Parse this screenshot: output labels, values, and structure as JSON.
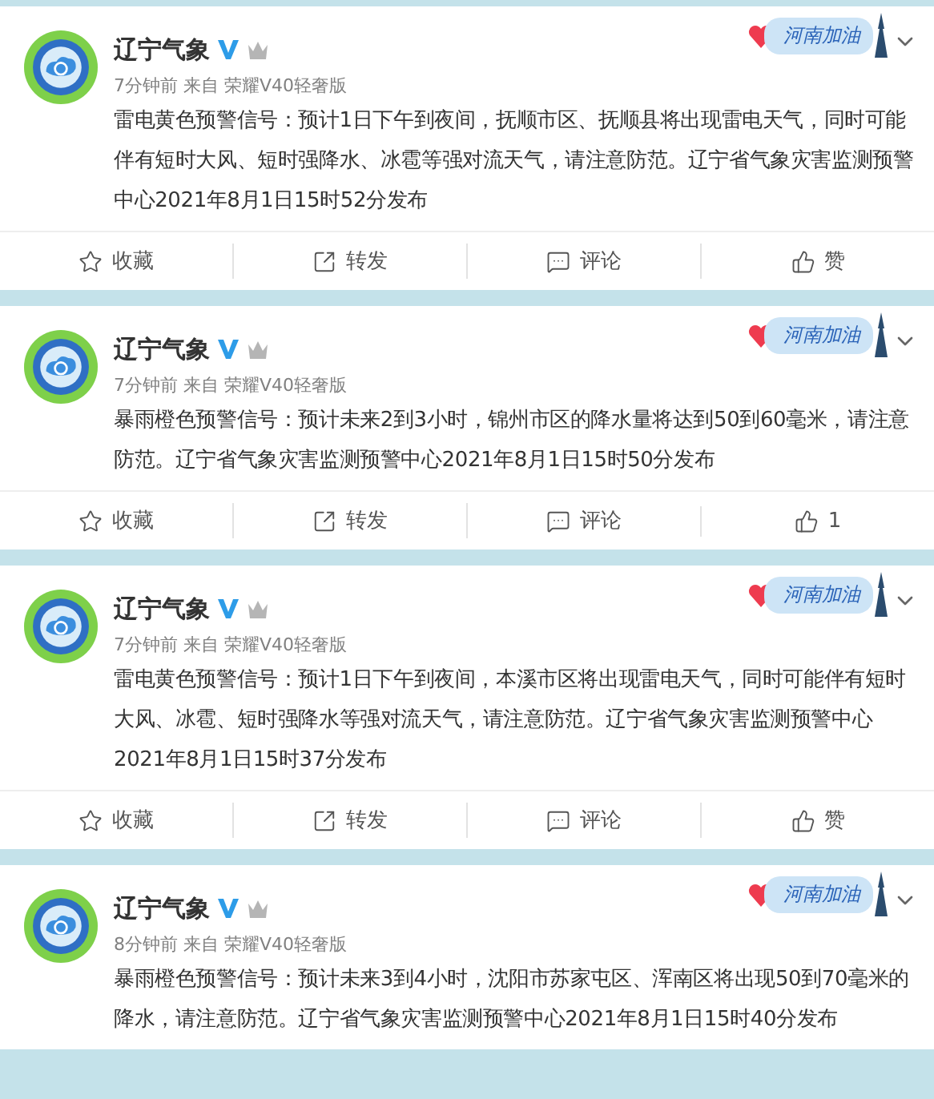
{
  "posts": [
    {
      "author": "辽宁气象",
      "badge": "河南加油",
      "meta": "7分钟前 来自 荣耀V40轻奢版",
      "text": "雷电黄色预警信号：预计1日下午到夜间，抚顺市区、抚顺县将出现雷电天气，同时可能伴有短时大风、短时强降水、冰雹等强对流天气，请注意防范。辽宁省气象灾害监测预警中心2021年8月1日15时52分发布",
      "actions": [
        {
          "kind": "favorite",
          "label": "收藏"
        },
        {
          "kind": "repost",
          "label": "转发"
        },
        {
          "kind": "comment",
          "label": "评论"
        },
        {
          "kind": "like",
          "label": "赞"
        }
      ]
    },
    {
      "author": "辽宁气象",
      "badge": "河南加油",
      "meta": "7分钟前 来自 荣耀V40轻奢版",
      "text": "暴雨橙色预警信号：预计未来2到3小时，锦州市区的降水量将达到50到60毫米，请注意防范。辽宁省气象灾害监测预警中心2021年8月1日15时50分发布",
      "actions": [
        {
          "kind": "favorite",
          "label": "收藏"
        },
        {
          "kind": "repost",
          "label": "转发"
        },
        {
          "kind": "comment",
          "label": "评论"
        },
        {
          "kind": "like",
          "label": "1"
        }
      ]
    },
    {
      "author": "辽宁气象",
      "badge": "河南加油",
      "meta": "7分钟前 来自 荣耀V40轻奢版",
      "text": "雷电黄色预警信号：预计1日下午到夜间，本溪市区将出现雷电天气，同时可能伴有短时大风、冰雹、短时强降水等强对流天气，请注意防范。辽宁省气象灾害监测预警中心2021年8月1日15时37分发布",
      "actions": [
        {
          "kind": "favorite",
          "label": "收藏"
        },
        {
          "kind": "repost",
          "label": "转发"
        },
        {
          "kind": "comment",
          "label": "评论"
        },
        {
          "kind": "like",
          "label": "赞"
        }
      ]
    },
    {
      "author": "辽宁气象",
      "badge": "河南加油",
      "meta": "8分钟前 来自 荣耀V40轻奢版",
      "text": "暴雨橙色预警信号：预计未来3到4小时，沈阳市苏家屯区、浑南区将出现50到70毫米的降水，请注意防范。辽宁省气象灾害监测预警中心2021年8月1日15时40分发布"
    }
  ]
}
